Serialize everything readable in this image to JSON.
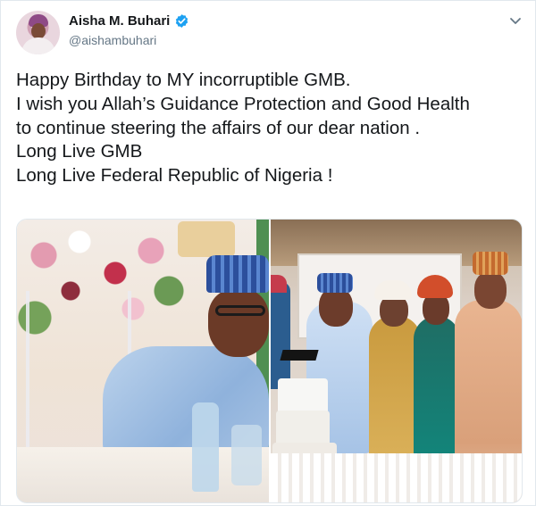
{
  "author": {
    "display_name": "Aisha M. Buhari",
    "handle": "@aishambuhari",
    "verified": true
  },
  "tweet": {
    "lines": [
      "Happy Birthday to MY incorruptible GMB.",
      "I wish you Allah’s Guidance Protection and Good Health",
      "to continue steering the affairs of our dear nation .",
      "Long Live GMB",
      "Long Live Federal Republic of Nigeria !"
    ]
  },
  "media": {
    "count": 2
  },
  "colors": {
    "text": "#14171a",
    "secondary": "#657786",
    "verified_blue": "#1da1f2",
    "border": "#e1e8ed"
  },
  "icons": {
    "verified": "verified-badge-icon",
    "menu": "chevron-down-icon"
  }
}
